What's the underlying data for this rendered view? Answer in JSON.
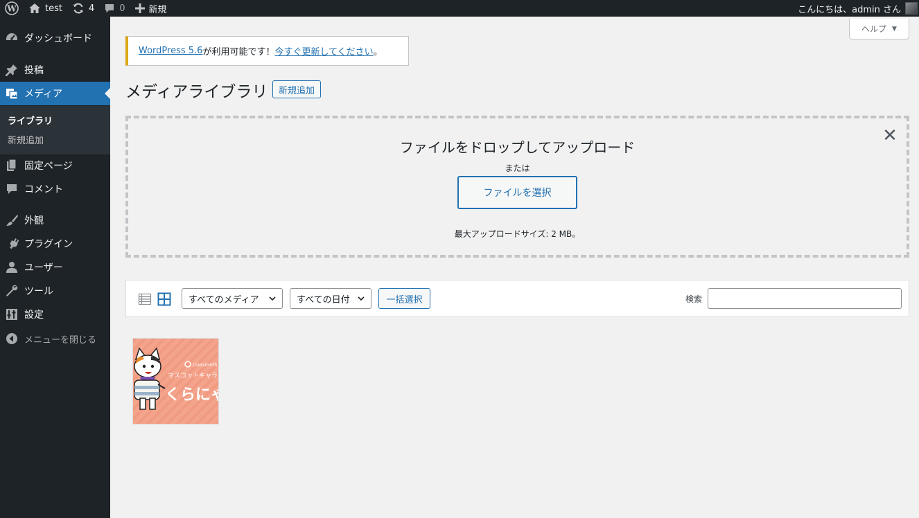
{
  "adminbar": {
    "site_name": "test",
    "updates_count": "4",
    "comments_count": "0",
    "new_label": "新規",
    "greeting": "こんにちは、admin さん"
  },
  "sidebar": {
    "items": [
      {
        "label": "ダッシュボード",
        "icon": "dashboard-icon"
      },
      {
        "label": "投稿",
        "icon": "pin-icon"
      },
      {
        "label": "メディア",
        "icon": "media-icon"
      },
      {
        "label": "固定ページ",
        "icon": "page-icon"
      },
      {
        "label": "コメント",
        "icon": "comment-icon"
      },
      {
        "label": "外観",
        "icon": "brush-icon"
      },
      {
        "label": "プラグイン",
        "icon": "plugin-icon"
      },
      {
        "label": "ユーザー",
        "icon": "user-icon"
      },
      {
        "label": "ツール",
        "icon": "wrench-icon"
      },
      {
        "label": "設定",
        "icon": "settings-icon"
      }
    ],
    "submenu": [
      {
        "label": "ライブラリ"
      },
      {
        "label": "新規追加"
      }
    ],
    "collapse_label": "メニューを閉じる"
  },
  "help": {
    "label": "ヘルプ"
  },
  "notice": {
    "link1": "WordPress 5.6",
    "middle": " が利用可能です！",
    "link2": "今すぐ更新してください",
    "end": "。"
  },
  "page": {
    "title": "メディアライブラリ",
    "add_new": "新規追加"
  },
  "uploader": {
    "title": "ファイルをドロップしてアップロード",
    "or": "または",
    "select_button": "ファイルを選択",
    "max_size": "最大アップロードサイズ: 2 MB。"
  },
  "toolbar": {
    "media_filter": "すべてのメディア",
    "date_filter": "すべての日付",
    "bulk_select": "一括選択",
    "search_label": "検索",
    "search_value": ""
  },
  "attachment": {
    "brand": "classmeth",
    "line1": "マスコットキャラ",
    "line2": "くらにゃ",
    "colors": {
      "bg": "#f5a48c",
      "stripe": "#f08f77"
    }
  }
}
